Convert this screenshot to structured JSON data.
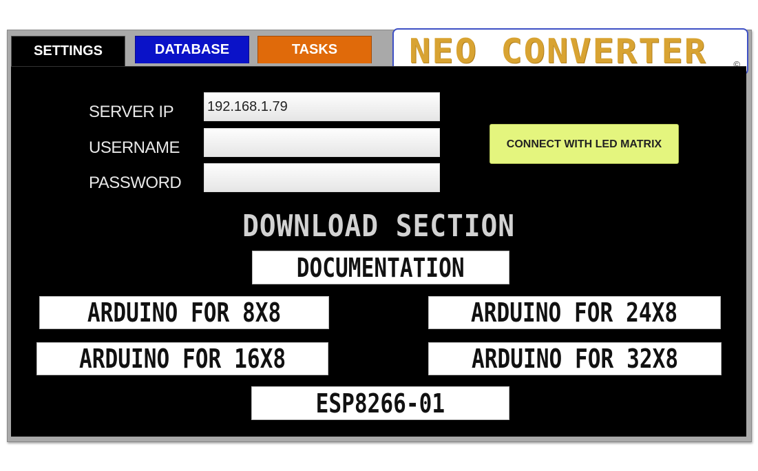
{
  "tabs": {
    "settings": "SETTINGS",
    "database": "DATABASE",
    "tasks": "TASKS"
  },
  "logo": {
    "text": "NEO CONVERTER",
    "copyright": "©"
  },
  "form": {
    "server_ip_label": "SERVER IP",
    "server_ip_value": "192.168.1.79",
    "username_label": "USERNAME",
    "username_value": "",
    "password_label": "PASSWORD",
    "password_value": ""
  },
  "connect_button": "CONNECT WITH LED MATRIX",
  "download": {
    "title": "DOWNLOAD SECTION",
    "documentation": "DOCUMENTATION",
    "arduino_8x8": "ARDUINO FOR 8X8",
    "arduino_24x8": "ARDUINO FOR 24X8",
    "arduino_16x8": "ARDUINO FOR 16X8",
    "arduino_32x8": "ARDUINO FOR 32X8",
    "esp8266": "ESP8266-01"
  },
  "colors": {
    "settings_tab": "#000000",
    "database_tab": "#0a12c8",
    "tasks_tab": "#e06a0a",
    "logo_text": "#d8a332",
    "connect_button": "#e4f57e"
  }
}
